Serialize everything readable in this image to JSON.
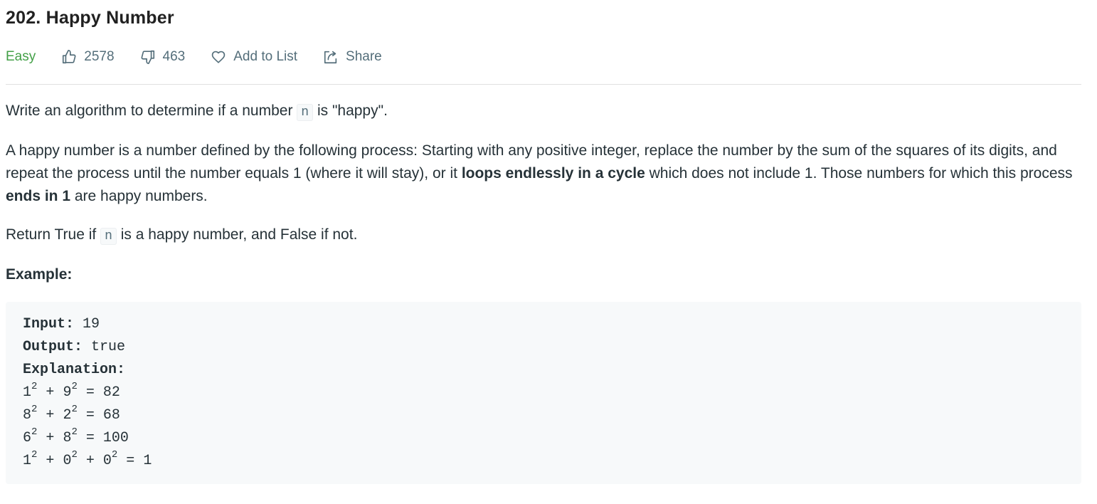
{
  "problem": {
    "title": "202. Happy Number",
    "difficulty": "Easy",
    "likes": "2578",
    "dislikes": "463",
    "add_to_list_label": "Add to List",
    "share_label": "Share",
    "icons": {
      "like": "thumbs-up-icon",
      "dislike": "thumbs-down-icon",
      "add_to_list": "heart-icon",
      "share": "share-icon"
    },
    "colors": {
      "difficulty_easy": "#43a047",
      "meta_text": "#546e7a"
    }
  },
  "description": {
    "p1": {
      "before": "Write an algorithm to determine if a number ",
      "code": "n",
      "after": " is \"happy\"."
    },
    "p2": {
      "part1": "A happy number is a number defined by the following process: Starting with any positive integer, replace the number by the sum of the squares of its digits, and repeat the process until the number equals 1 (where it will stay), or it ",
      "bold1": "loops endlessly in a cycle",
      "part2": " which does not include 1. Those numbers for which this process ",
      "bold2": "ends in 1",
      "part3": " are happy numbers."
    },
    "p3": {
      "before": "Return True if ",
      "code": "n",
      "after": " is a happy number, and False if not."
    },
    "example_heading": "Example:"
  },
  "example": {
    "input_label": "Input:",
    "input_value": " 19",
    "output_label": "Output:",
    "output_value": " true",
    "explanation_label": "Explanation:",
    "lines": [
      {
        "a": "1",
        "b": "9",
        "c": null,
        "result": "82"
      },
      {
        "a": "8",
        "b": "2",
        "c": null,
        "result": "68"
      },
      {
        "a": "6",
        "b": "8",
        "c": null,
        "result": "100"
      },
      {
        "a": "1",
        "b": "0",
        "c": "0",
        "result": "1"
      }
    ],
    "exponent": "2",
    "plus": " + ",
    "equals": " = "
  }
}
